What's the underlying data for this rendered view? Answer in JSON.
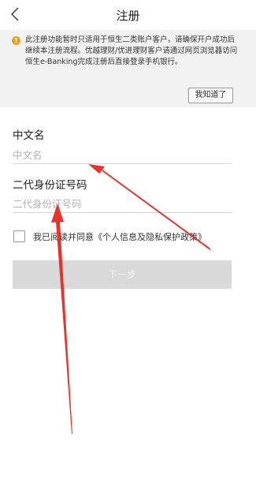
{
  "header": {
    "title": "注册",
    "back_icon": "chevron-left-icon"
  },
  "notice": {
    "icon": "info-icon",
    "icon_color": "#f0a21b",
    "text": "此注册功能暂时只适用于恒生二类账户客户，请确保开户成功后继续本注册流程。优越理财/优进理财客户请通过网页浏览器访问恒生e-Banking完成注册后直接登录手机银行。",
    "ack_label": "我知道了"
  },
  "form": {
    "chinese_name": {
      "label": "中文名",
      "placeholder": "中文名",
      "value": ""
    },
    "id_number": {
      "label": "二代身份证号码",
      "placeholder": "二代身份证号码",
      "value": ""
    },
    "agreement": {
      "checked": false,
      "text": "我已阅读并同意《个人信息及隐私保护政策》"
    },
    "next_label": "下一步"
  },
  "colors": {
    "annotation_arrow": "#e8322b",
    "notice_background": "#f2f2f2",
    "disabled_button": "#d9d9d9"
  }
}
